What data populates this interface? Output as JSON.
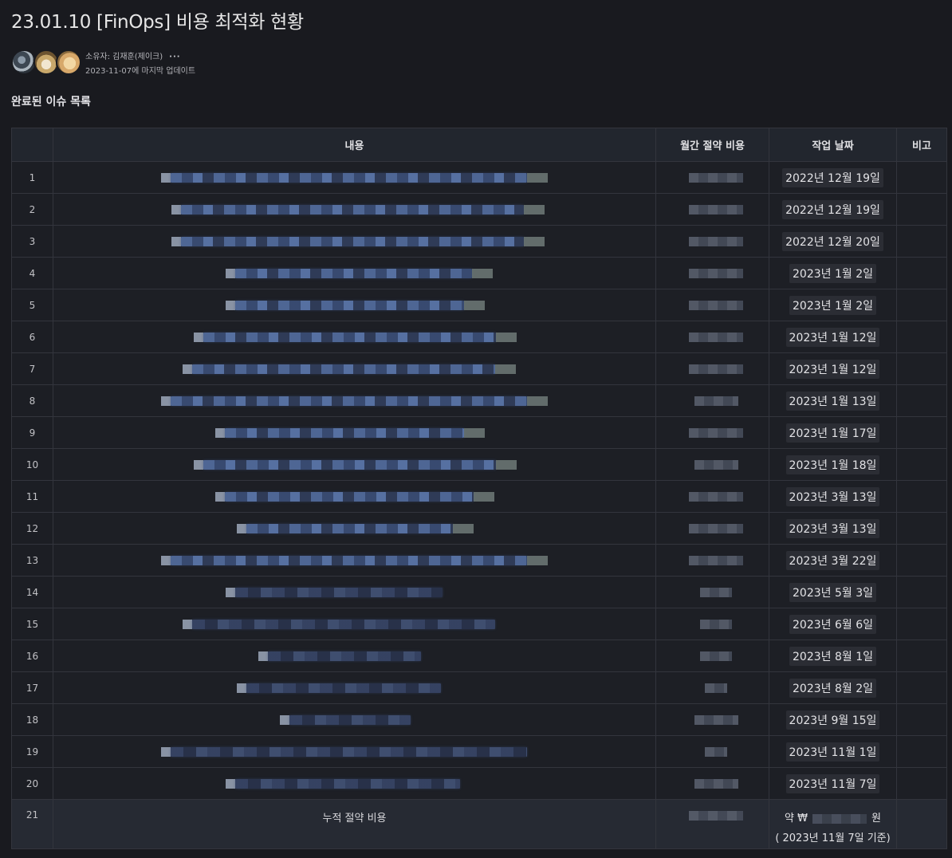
{
  "page": {
    "title": "23.01.10 [FinOps] 비용 최적화 현황",
    "owner_label": "소유자: 김재훈(제이크)",
    "more_label": "···",
    "updated_label": "2023-11-07에 마지막 업데이트",
    "section_title": "완료된 이슈 목록"
  },
  "table": {
    "headers": [
      "",
      "내용",
      "월간 절약 비용",
      "작업 날짜",
      "비고"
    ],
    "rows": [
      {
        "index": "1",
        "date": "2022년 12월 19일"
      },
      {
        "index": "2",
        "date": "2022년 12월 19일"
      },
      {
        "index": "3",
        "date": "2022년 12월 20일"
      },
      {
        "index": "4",
        "date": "2023년 1월 2일"
      },
      {
        "index": "5",
        "date": "2023년 1월 2일"
      },
      {
        "index": "6",
        "date": "2023년 1월 12일"
      },
      {
        "index": "7",
        "date": "2023년 1월 12일"
      },
      {
        "index": "8",
        "date": "2023년 1월 13일"
      },
      {
        "index": "9",
        "date": "2023년 1월 17일"
      },
      {
        "index": "10",
        "date": "2023년 1월 18일"
      },
      {
        "index": "11",
        "date": "2023년 3월 13일"
      },
      {
        "index": "12",
        "date": "2023년 3월 13일"
      },
      {
        "index": "13",
        "date": "2023년 3월 22일"
      },
      {
        "index": "14",
        "date": "2023년 5월 3일"
      },
      {
        "index": "15",
        "date": "2023년 6월 6일"
      },
      {
        "index": "16",
        "date": "2023년 8월 1일"
      },
      {
        "index": "17",
        "date": "2023년 8월 2일"
      },
      {
        "index": "18",
        "date": "2023년 9월 15일"
      },
      {
        "index": "19",
        "date": "2023년 11월 1일"
      },
      {
        "index": "20",
        "date": "2023년 11월 7일"
      }
    ],
    "total": {
      "index": "21",
      "label": "누적 절약 비용",
      "amount_prefix": "약 ₩",
      "amount_suffix": "원",
      "as_of": "( 2023년 11월 7일  기준)"
    }
  }
}
